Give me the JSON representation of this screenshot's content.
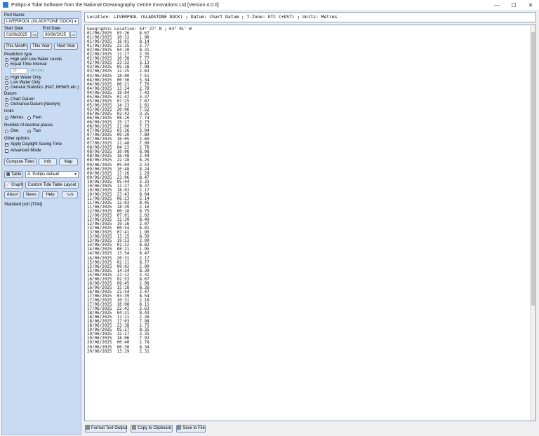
{
  "window": {
    "title": "Poltips-4 Tidal Software from the National Oceanography Centre Innovations Ltd  [Version 4.0.0]",
    "minimize": "—",
    "maximize": "☐",
    "close": "✕"
  },
  "panel": {
    "port_name_label": "Port Name",
    "port_name": "LIVERPOOL (GLADSTONE DOCK)",
    "start_date_label": "Start Date",
    "end_date_label": "End Date",
    "start_date": "01/06/2025",
    "end_date": "30/06/2025",
    "cal_label": "cal",
    "this_month": "This Month",
    "this_year": "This Year",
    "next_year": "Next Year",
    "prediction_type_label": "Prediction type",
    "pred_options": [
      "High and Low Water Levels",
      "Equal Time Interval",
      "High Water Only",
      "Low Water Only",
      "General Statistics (HAT, MHWS etc.)"
    ],
    "interval_value": "15",
    "interval_unit": "minutes",
    "datum_label": "Datum",
    "datum_options": [
      "Chart Datum",
      "Ordnance Datum (Newlyn)"
    ],
    "units_label": "Units",
    "units_options": [
      "Metres",
      "Feet"
    ],
    "decimals_label": "Number of decimal places",
    "decimals_options": [
      "One",
      "Two"
    ],
    "other_label": "Other options",
    "apply_dst": "Apply Daylight Saving Time",
    "advanced_mode": "Advanced Mode",
    "compute_tides": "Compute Tides",
    "info": "Info",
    "map": "Map",
    "table": "Table",
    "table_layout": "A. Poltips default",
    "graph": "Graph",
    "custom_layout": "Custom Tide Table Layout",
    "about": "About",
    "news": "News",
    "help": "Help",
    "wave_symbol": "∿◷",
    "standard_port": "Standard port [TGN]"
  },
  "header_line": "Location: LIVERPOOL (GLADSTONE DOCK) ; Datum: Chart Datum ; T-Zone: UTC (+DST) ; Units: Metres",
  "geo_line": "Geographic Location: 53° 27' N ; 03° 01' W",
  "tides": [
    [
      "01/06/2025",
      "03:26",
      "8.67"
    ],
    [
      "01/06/2025",
      "10:32",
      "1.98"
    ],
    [
      "01/06/2025",
      "16:01",
      "8.14"
    ],
    [
      "01/06/2025",
      "22:35",
      "2.77"
    ],
    [
      "02/06/2025",
      "04:20",
      "8.31"
    ],
    [
      "02/06/2025",
      "11:27",
      "2.35"
    ],
    [
      "02/06/2025",
      "16:58",
      "7.77"
    ],
    [
      "02/06/2025",
      "23:32",
      "3.13"
    ],
    [
      "03/06/2025",
      "05:18",
      "7.98"
    ],
    [
      "03/06/2025",
      "12:25",
      "2.63"
    ],
    [
      "03/06/2025",
      "18:00",
      "7.51"
    ],
    [
      "04/06/2025",
      "00:36",
      "3.34"
    ],
    [
      "04/06/2025",
      "06:21",
      "7.76"
    ],
    [
      "04/06/2025",
      "13:24",
      "2.78"
    ],
    [
      "04/06/2025",
      "19:04",
      "7.43"
    ],
    [
      "05/06/2025",
      "01:42",
      "3.37"
    ],
    [
      "05/06/2025",
      "07:25",
      "7.67"
    ],
    [
      "05/06/2025",
      "14:23",
      "2.81"
    ],
    [
      "05/06/2025",
      "20:06",
      "7.52"
    ],
    [
      "06/06/2025",
      "02:42",
      "3.25"
    ],
    [
      "06/06/2025",
      "08:20",
      "7.74"
    ],
    [
      "06/06/2025",
      "15:17",
      "2.73"
    ],
    [
      "06/06/2025",
      "21:00",
      "7.73"
    ],
    [
      "07/06/2025",
      "03:36",
      "3.04"
    ],
    [
      "07/06/2025",
      "09:20",
      "7.89"
    ],
    [
      "07/06/2025",
      "16:05",
      "2.60"
    ],
    [
      "07/06/2025",
      "21:48",
      "7.99"
    ],
    [
      "08/06/2025",
      "04:22",
      "2.78"
    ],
    [
      "08/06/2025",
      "10:06",
      "8.08"
    ],
    [
      "08/06/2025",
      "16:48",
      "2.44"
    ],
    [
      "08/06/2025",
      "22:28",
      "8.25"
    ],
    [
      "09/06/2025",
      "05:04",
      "2.53"
    ],
    [
      "09/06/2025",
      "10:48",
      "8.24"
    ],
    [
      "09/06/2025",
      "17:26",
      "2.29"
    ],
    [
      "09/06/2025",
      "23:06",
      "8.47"
    ],
    [
      "10/06/2025",
      "05:44",
      "2.31"
    ],
    [
      "10/06/2025",
      "11:27",
      "8.37"
    ],
    [
      "10/06/2025",
      "18:03",
      "2.17"
    ],
    [
      "10/06/2025",
      "23:43",
      "8.64"
    ],
    [
      "11/06/2025",
      "06:23",
      "2.14"
    ],
    [
      "11/06/2025",
      "12:03",
      "8.45"
    ],
    [
      "11/06/2025",
      "18:39",
      "2.10"
    ],
    [
      "12/06/2025",
      "00:18",
      "8.75"
    ],
    [
      "12/06/2025",
      "07:01",
      "2.02"
    ],
    [
      "12/06/2025",
      "12:39",
      "8.49"
    ],
    [
      "12/06/2025",
      "19:16",
      "2.07"
    ],
    [
      "13/06/2025",
      "00:54",
      "8.81"
    ],
    [
      "13/06/2025",
      "07:41",
      "1.96"
    ],
    [
      "13/06/2025",
      "13:15",
      "8.50"
    ],
    [
      "13/06/2025",
      "19:53",
      "2.09"
    ],
    [
      "14/06/2025",
      "01:32",
      "8.82"
    ],
    [
      "14/06/2025",
      "08:21",
      "1.95"
    ],
    [
      "14/06/2025",
      "13:54",
      "8.47"
    ],
    [
      "14/06/2025",
      "20:31",
      "2.17"
    ],
    [
      "15/06/2025",
      "02:11",
      "8.77"
    ],
    [
      "15/06/2025",
      "09:02",
      "2.00"
    ],
    [
      "15/06/2025",
      "14:34",
      "8.39"
    ],
    [
      "15/06/2025",
      "21:12",
      "2.31"
    ],
    [
      "16/06/2025",
      "02:53",
      "8.67"
    ],
    [
      "16/06/2025",
      "09:45",
      "2.08"
    ],
    [
      "16/06/2025",
      "15:18",
      "8.26"
    ],
    [
      "16/06/2025",
      "21:54",
      "2.47"
    ],
    [
      "17/06/2025",
      "03:39",
      "8.54"
    ],
    [
      "17/06/2025",
      "10:31",
      "2.18"
    ],
    [
      "17/06/2025",
      "16:08",
      "8.11"
    ],
    [
      "17/06/2025",
      "22:42",
      "2.63"
    ],
    [
      "18/06/2025",
      "04:31",
      "8.43"
    ],
    [
      "18/06/2025",
      "11:21",
      "2.26"
    ],
    [
      "18/06/2025",
      "17:03",
      "7.98"
    ],
    [
      "18/06/2025",
      "23:38",
      "2.75"
    ],
    [
      "19/06/2025",
      "05:27",
      "8.35"
    ],
    [
      "19/06/2025",
      "12:17",
      "2.31"
    ],
    [
      "19/06/2025",
      "18:06",
      "7.92"
    ],
    [
      "20/06/2025",
      "00:40",
      "2.78"
    ],
    [
      "20/06/2025",
      "06:30",
      "8.34"
    ],
    [
      "20/06/2025",
      "13:19",
      "2.31"
    ]
  ],
  "bottom": {
    "format_text": "Format Text Output",
    "copy_clipboard": "Copy to Clipboard",
    "save_file": "Save to File"
  }
}
